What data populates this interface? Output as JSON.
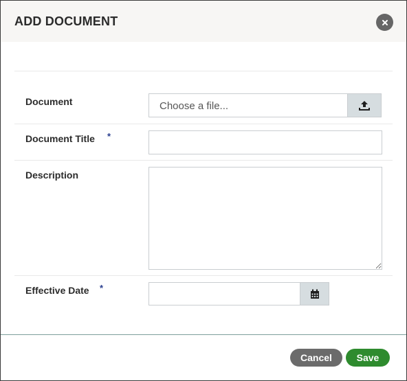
{
  "dialog": {
    "title": "ADD DOCUMENT",
    "close_icon": "close-icon"
  },
  "form": {
    "document": {
      "label": "Document",
      "placeholder": "Choose a file...",
      "button_icon": "upload-icon"
    },
    "document_title": {
      "label": "Document Title",
      "required_marker": "*",
      "value": ""
    },
    "description": {
      "label": "Description",
      "value": ""
    },
    "effective_date": {
      "label": "Effective Date",
      "required_marker": "*",
      "value": "",
      "button_icon": "calendar-icon"
    }
  },
  "footer": {
    "cancel_label": "Cancel",
    "save_label": "Save"
  },
  "colors": {
    "save": "#2e8b2e",
    "cancel": "#6b6b6b",
    "required": "#2a3f8f",
    "header_bg": "#f7f6f4"
  }
}
